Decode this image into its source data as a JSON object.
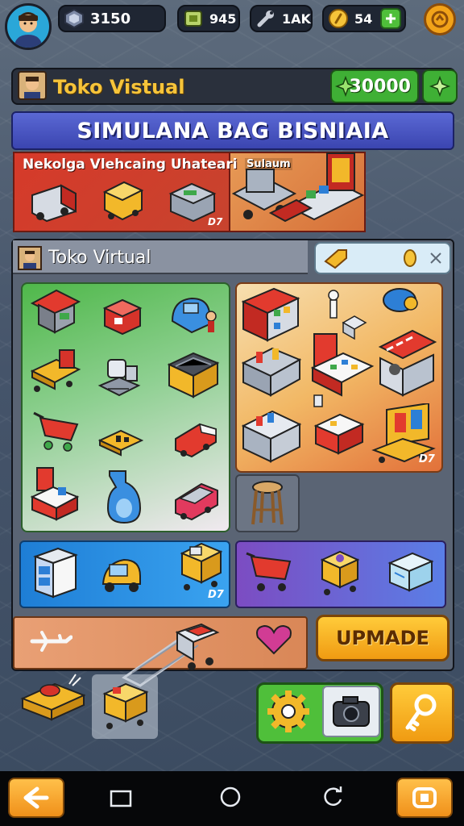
{
  "top_bar": {
    "gems": "3150",
    "stock": "945",
    "tools": "1AK",
    "coins": "54"
  },
  "shop": {
    "name": "Toko Vistual",
    "cash": "30000"
  },
  "banner": {
    "title": "SIMULANA BAG BISNIAIA"
  },
  "promo": {
    "title": "Nekolga Vlehcaing Uhateari",
    "subtitle": "Sulaum",
    "tag": "D7"
  },
  "inventory": {
    "title": "Toko Virtual",
    "grid_tag": "D7",
    "row_tag": "D7"
  },
  "actions": {
    "upgrade_label": "UPMADE"
  },
  "colors": {
    "accent_green": "#3fb035",
    "accent_orange": "#f09b12",
    "banner_blue": "#3b45b0"
  },
  "icons": {
    "top": [
      "avatar",
      "gem-icon",
      "crate-icon",
      "wrench-icon",
      "coin-icon",
      "plus-icon",
      "token-icon"
    ],
    "shop": [
      "shopkeeper-icon",
      "cash-icon",
      "plus-icon"
    ],
    "search": [
      "tag-icon",
      "coin-icon",
      "close-icon"
    ],
    "nav": [
      "back-icon",
      "square-icon",
      "home-icon",
      "recents-icon",
      "camera-icon"
    ]
  }
}
